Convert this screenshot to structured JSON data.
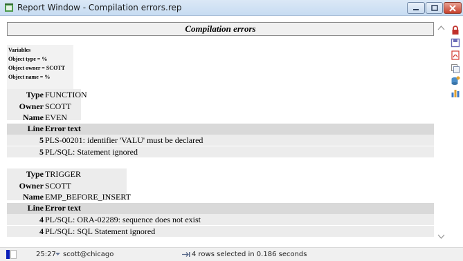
{
  "window": {
    "title": "Report Window - Compilation errors.rep"
  },
  "report": {
    "header": "Compilation errors",
    "variables": [
      "Variables",
      "Object type = %",
      "Object owner = SCOTT",
      "Object name = %"
    ],
    "labels": {
      "type": "Type",
      "owner": "Owner",
      "name": "Name",
      "line": "Line",
      "error_text": "Error text"
    },
    "objects": [
      {
        "type": "FUNCTION",
        "owner": "SCOTT",
        "name": "EVEN",
        "errors": [
          {
            "line": "5",
            "text": "PLS-00201: identifier 'VALU' must be declared"
          },
          {
            "line": "5",
            "text": "PL/SQL: Statement ignored"
          }
        ]
      },
      {
        "type": "TRIGGER",
        "owner": "SCOTT",
        "name": "EMP_BEFORE_INSERT",
        "errors": [
          {
            "line": "4",
            "text": "PL/SQL: ORA-02289: sequence does not exist"
          },
          {
            "line": "4",
            "text": "PL/SQL: SQL Statement ignored"
          }
        ]
      }
    ]
  },
  "statusbar": {
    "position": "25:27",
    "connection": "scott@chicago",
    "message": "4 rows selected in 0.186 seconds"
  },
  "icons": {
    "window": "report-window-icon",
    "minimize": "minimize-icon",
    "maximize": "maximize-icon",
    "close": "close-icon",
    "scroll_up": "chevron-up-icon",
    "scroll_down": "chevron-down-icon",
    "toolbar": [
      "lock-icon",
      "save-icon",
      "pdf-icon",
      "copy-icon",
      "database-icon",
      "bar-chart-icon"
    ],
    "connection_dropdown": "dropdown-arrow-icon",
    "rows": "rows-icon"
  },
  "colors": {
    "header_bg": "#f0f0f0",
    "shade_light": "#ececec",
    "shade_dark": "#d9d9d9",
    "lock": "#c0302b",
    "save": "#6b6bb8",
    "pdf": "#d23a2e",
    "chart": "#3d78c4",
    "status_indicator": "#0a1fb8"
  }
}
